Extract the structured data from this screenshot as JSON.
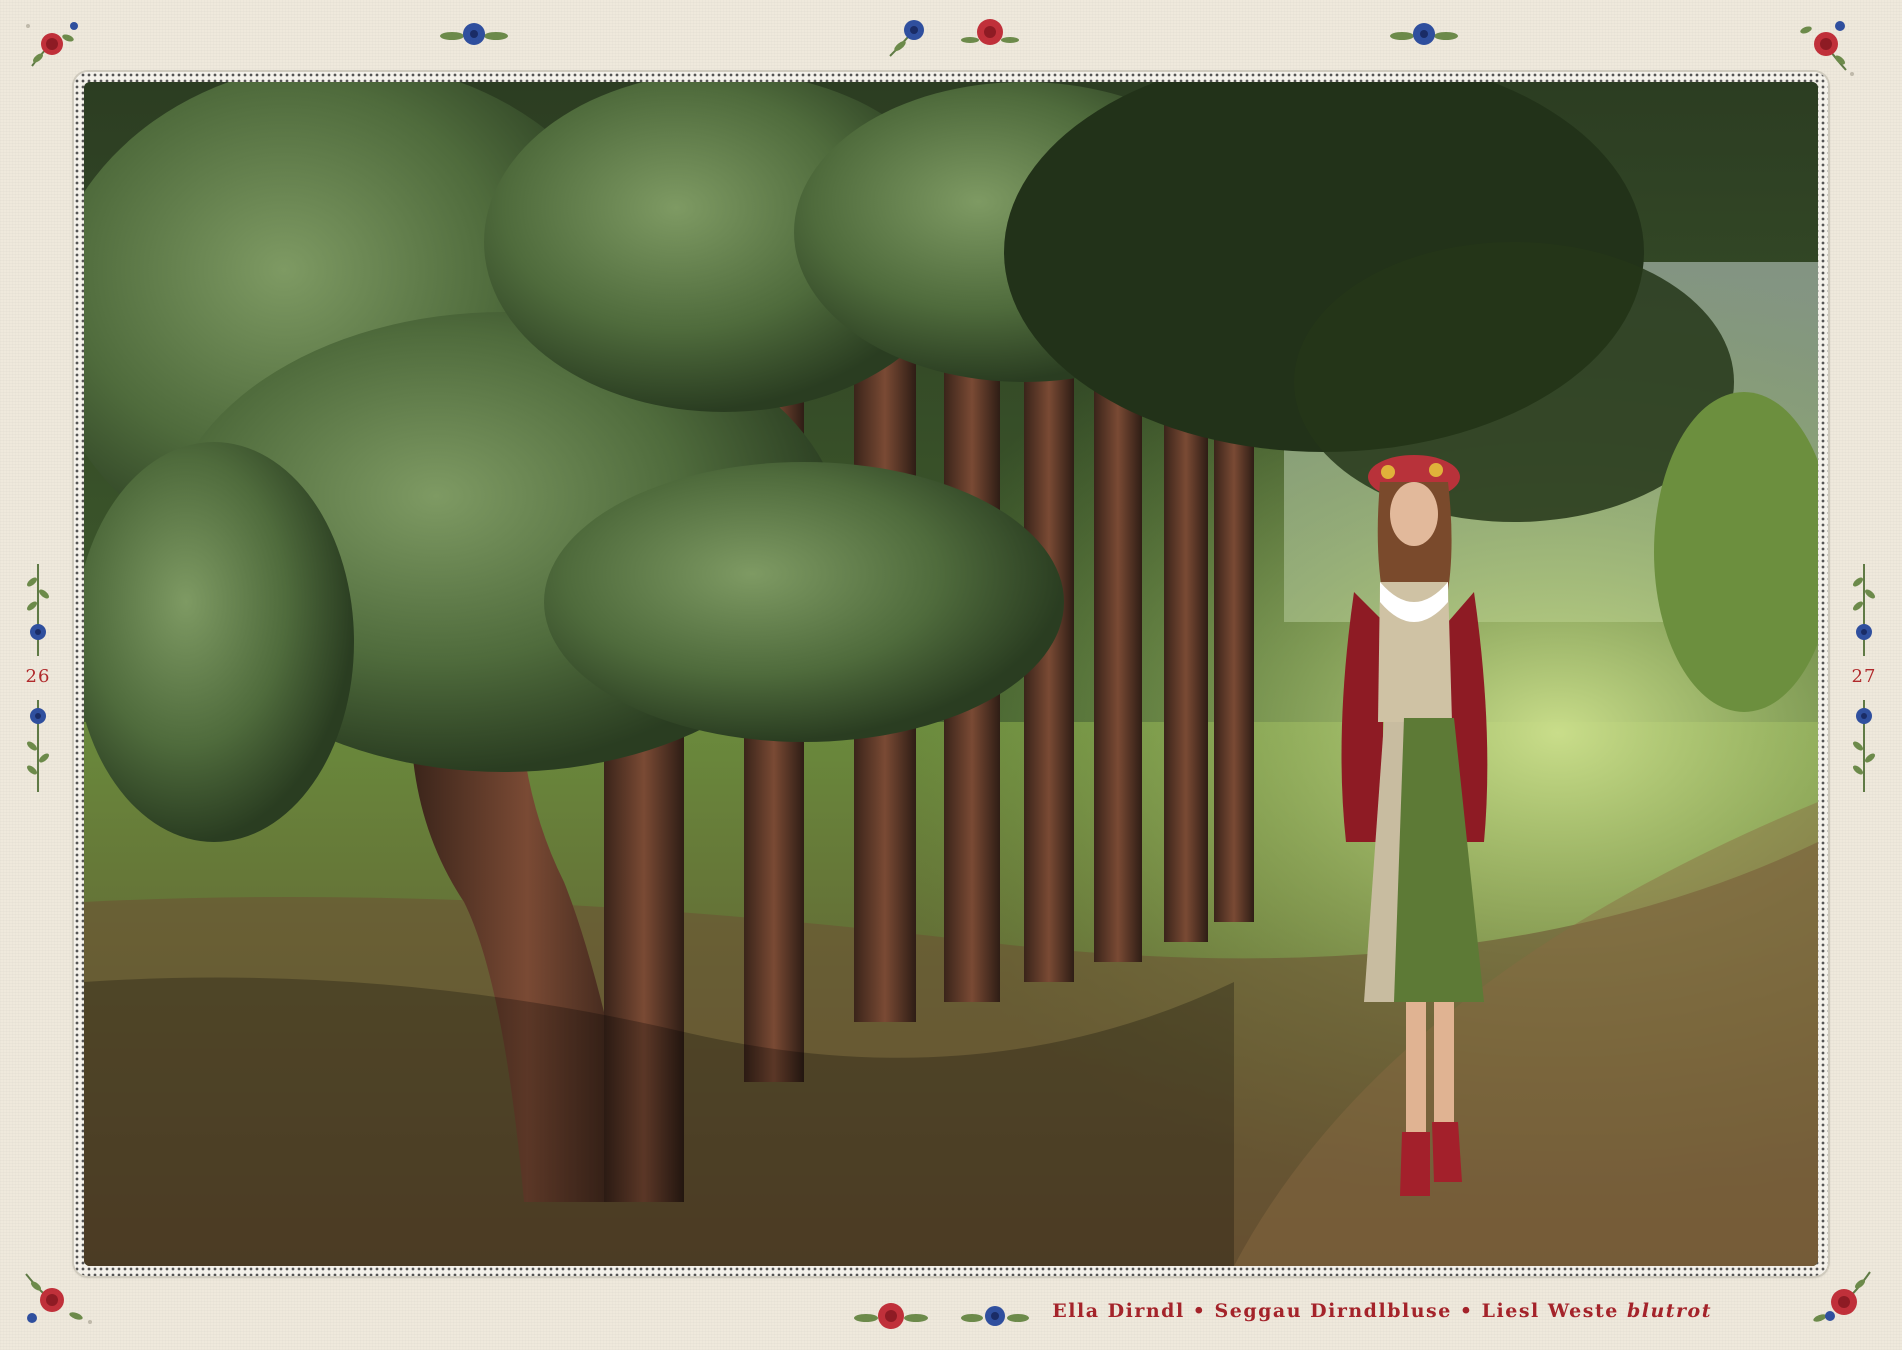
{
  "page_numbers": {
    "left": "26",
    "right": "27"
  },
  "caption": {
    "item_1": "Ella Dirndl",
    "separator_1": " • ",
    "item_2": "Seggau Dirndlbluse",
    "separator_2": " • ",
    "item_3": "Liesl Weste",
    "color_name": "blutrot"
  },
  "colors": {
    "background": "#efe9dc",
    "accent_red": "#a4232a",
    "rose": "#c0303a",
    "cornflower": "#2f4f9e",
    "leaf": "#5f7a45"
  },
  "ornaments": {
    "top_row": [
      "rose-icon",
      "cornflower-icon",
      "cornflower-icon",
      "rose-icon",
      "cornflower-icon",
      "rose-icon"
    ],
    "side_sprigs": [
      "cornflower-sprig-icon"
    ],
    "bottom_row": [
      "rose-icon",
      "rose-icon",
      "cornflower-icon",
      "rose-icon"
    ]
  }
}
